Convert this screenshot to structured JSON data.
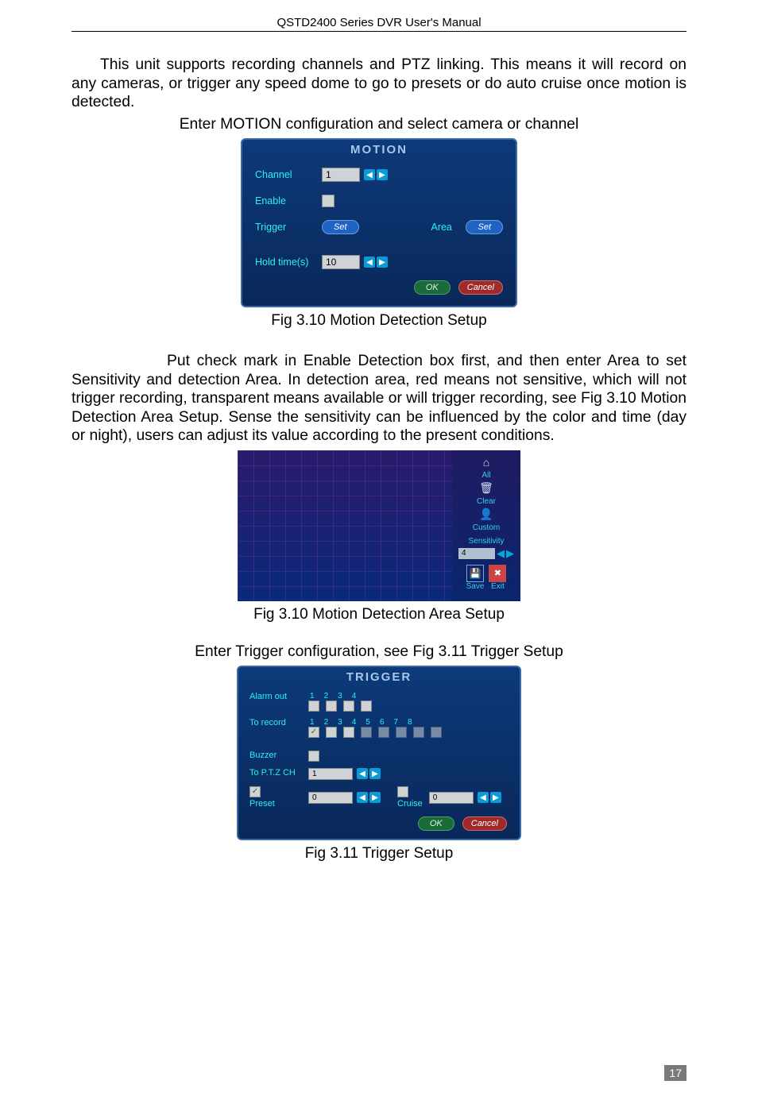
{
  "header": {
    "title": "QSTD2400 Series DVR User's Manual"
  },
  "para1": "This unit supports recording channels and PTZ linking. This means it will record on any cameras, or trigger any speed dome to go to presets or do auto cruise once motion is detected.",
  "motion_intro": "Enter MOTION configuration and select camera or channel",
  "motion_dialog": {
    "title": "MOTION",
    "channel_label": "Channel",
    "channel_value": "1",
    "enable_label": "Enable",
    "trigger_label": "Trigger",
    "trigger_set": "Set",
    "area_label": "Area",
    "area_set": "Set",
    "hold_label": "Hold time(s)",
    "hold_value": "10",
    "ok": "OK",
    "cancel": "Cancel"
  },
  "caption_motion": "Fig 3.10 Motion Detection Setup",
  "para2": "Put check mark in Enable Detection box first, and then enter Area to set Sensitivity and detection Area. In detection area, red means not sensitive, which will not trigger recording, transparent means available or will trigger recording, see Fig 3.10 Motion Detection Area Setup. Sense the sensitivity can be influenced by the color and time (day or night), users can adjust its value according to the present conditions.",
  "area_panel": {
    "all": "All",
    "clear": "Clear",
    "custom": "Custom",
    "sensitivity_label": "Sensitivity",
    "sensitivity_value": "4",
    "save": "Save",
    "exit": "Exit"
  },
  "caption_area": "Fig 3.10 Motion Detection Area Setup",
  "trigger_intro": "Enter Trigger configuration, see Fig 3.11 Trigger Setup",
  "trigger_dialog": {
    "title": "TRIGGER",
    "alarm_out_label": "Alarm out",
    "alarm_nums": [
      "1",
      "2",
      "3",
      "4"
    ],
    "record_label": "To record",
    "record_nums": [
      "1",
      "2",
      "3",
      "4",
      "5",
      "6",
      "7",
      "8"
    ],
    "buzzer_label": "Buzzer",
    "ptz_label": "To P.T.Z CH",
    "ptz_value": "1",
    "preset_label": "Preset",
    "preset_value": "0",
    "cruise_label": "Cruise",
    "cruise_value": "0",
    "ok": "OK",
    "cancel": "Cancel"
  },
  "caption_trigger": "Fig 3.11 Trigger Setup",
  "page_number": "17"
}
